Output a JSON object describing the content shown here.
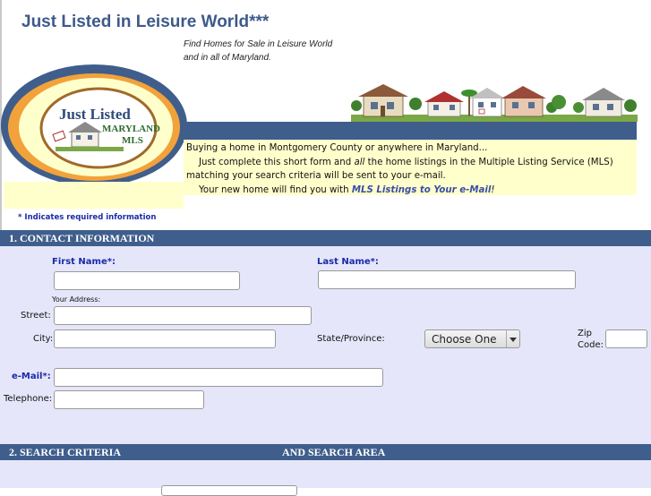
{
  "header": {
    "title": "Just Listed in Leisure World***",
    "tagline_line1": "Find Homes for Sale in Leisure World",
    "tagline_line2": "and in all of Maryland."
  },
  "logo": {
    "line1": "Just Listed",
    "line2": "MARYLAND",
    "line3": "MLS"
  },
  "intro": {
    "line1": "Buying a home in Montgomery County or anywhere in Maryland...",
    "line2_a": "Just complete this short form and ",
    "line2_em": "all",
    "line2_b": " the home listings in the Multiple Listing Service (MLS)",
    "line3": "matching your search criteria will be sent to your e-mail.",
    "line4_a": "Your new home will find you with ",
    "line4_link": "MLS Listings to Your e-Mail",
    "line4_b": "!"
  },
  "required_note": "* Indicates required information",
  "section1": {
    "title": "1.  CONTACT INFORMATION"
  },
  "form": {
    "first_name_label": "First Name*:",
    "last_name_label": "Last Name*:",
    "your_address_label": "Your Address:",
    "street_label": "Street:",
    "city_label": "City:",
    "state_label": "State/Province:",
    "state_value": "Choose One",
    "zip_label_1": "Zip",
    "zip_label_2": "Code:",
    "email_label": "e-Mail*:",
    "telephone_label": "Telephone:"
  },
  "section2": {
    "title_left": "2.  SEARCH CRITERIA",
    "title_right": "AND SEARCH AREA"
  },
  "colors": {
    "header_blue": "#3f5e8c",
    "title_blue": "#3d5a8a",
    "intro_yellow": "#ffffcc",
    "form_lavender": "#e6e6fa",
    "required_blue": "#1a2aa8"
  }
}
